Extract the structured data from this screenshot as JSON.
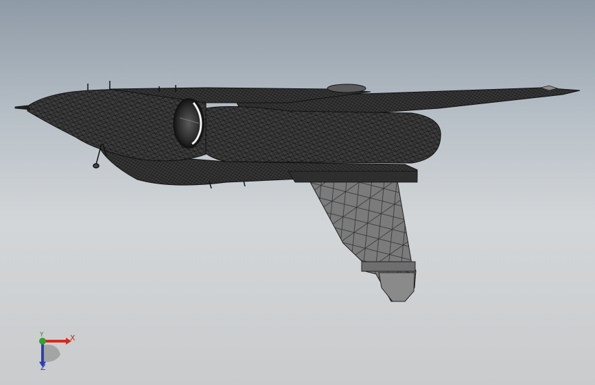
{
  "viewport": {
    "background_top": "#8e9aa6",
    "background_bottom": "#c9cbcd",
    "display_mode": "wireframe-mesh"
  },
  "model": {
    "body_color": "#3a3a3a",
    "mesh_line_color": "#111111",
    "wing_color": "#7a7a7a"
  },
  "triad": {
    "x_label": "X",
    "y_label": "Y",
    "z_label": "Z",
    "x_color": "#d42a1e",
    "y_color": "#33a033",
    "z_color": "#2a3fb8"
  }
}
